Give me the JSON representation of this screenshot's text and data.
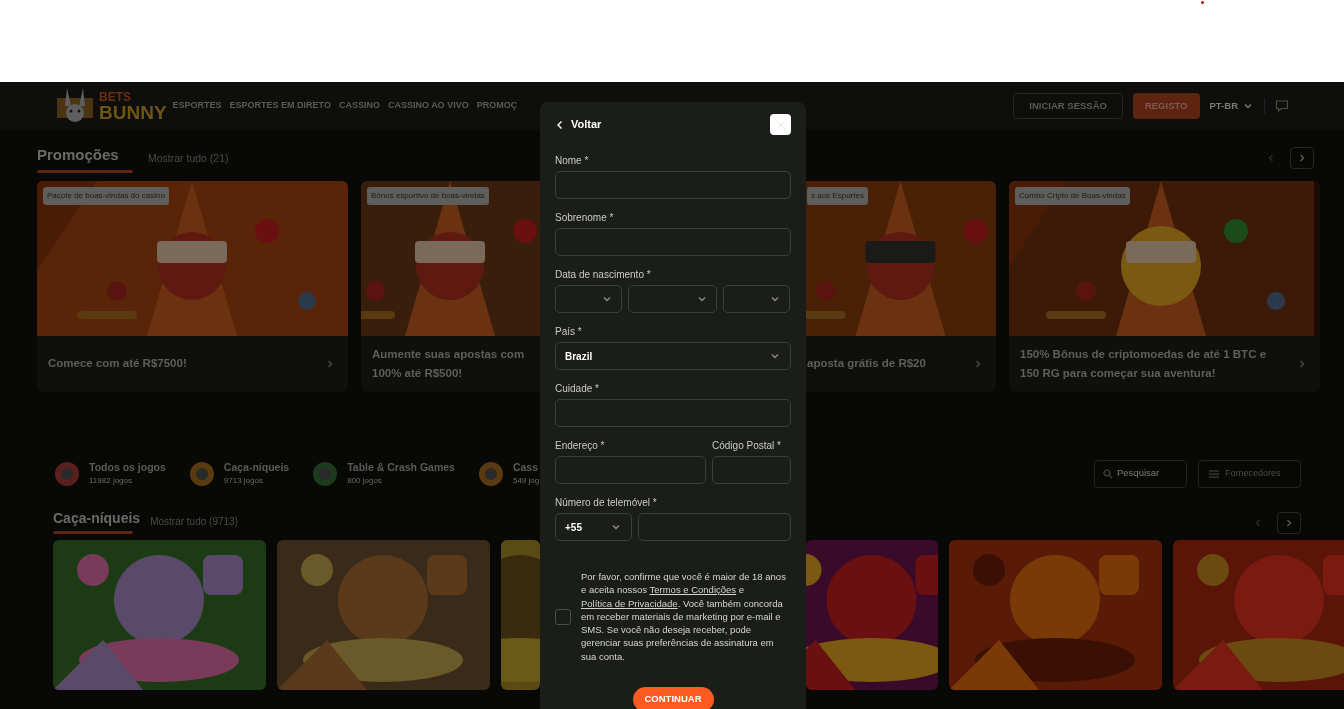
{
  "header": {
    "logo": {
      "line1": "BETS",
      "line2": "BUNNY"
    },
    "nav": [
      "ESPORTES",
      "ESPORTES EM DIRETO",
      "CASSINO",
      "CASSINO AO VIVO",
      "PROMOÇ"
    ],
    "login": "INICIAR SESSÃO",
    "register": "REGISTO",
    "language": "PT-BR"
  },
  "promotions": {
    "title": "Promoções",
    "show_all": "Mostrar tudo (21)",
    "cards": [
      {
        "tag": "Pacote de boas-vindas do casino",
        "text": "Comece com até R$7500!"
      },
      {
        "tag": "Bônus esportivo de boas-vindas",
        "text": "Aumente suas apostas com 100% até R$500!"
      },
      {
        "tag": "s aos Esportes",
        "text": "aposta grátis de R$20"
      },
      {
        "tag": "Combo Cripto de Boas-vindas",
        "text": "150% Bônus de criptomoedas de até 1 BTC e 150 RG para começar sua aventura!"
      }
    ]
  },
  "categories": [
    {
      "name": "Todos os jogos",
      "count": "11982 jogos"
    },
    {
      "name": "Caça-níqueis",
      "count": "9713 jogos"
    },
    {
      "name": "Table & Crash Games",
      "count": "800 jogos"
    },
    {
      "name": "Cass",
      "count": "549 jog"
    }
  ],
  "search": {
    "placeholder": "Pesquisar"
  },
  "providers": "Fornecedores",
  "slots": {
    "title": "Caça-níqueis",
    "show_all": "Mostrar tudo (9713)"
  },
  "registration_modal": {
    "back": "Voltar",
    "name": {
      "label": "Nome *"
    },
    "surname": {
      "label": "Sobrenome *"
    },
    "birth_date": {
      "label": "Data de nascimento *"
    },
    "country": {
      "label": "País *",
      "value": "Brazil"
    },
    "city": {
      "label": "Cuidade *"
    },
    "address": {
      "label": "Endereço *"
    },
    "postal_code": {
      "label": "Código Postal *"
    },
    "phone": {
      "label": "Número de telemóvel *",
      "code": "+55"
    },
    "consent": {
      "checked": false,
      "text_before": "Por favor, confirme que você é maior de 18 anos e aceita nossos ",
      "terms_link": "Termos e Condições",
      "between": " e ",
      "privacy_link": "Política de Privacidade",
      "text_after": ". Você também concorda em receber materiais de marketing por e-mail e SMS. Se você não deseja receber, pode gerenciar suas preferências de assinatura em sua conta."
    },
    "continue": "CONTINUAR"
  }
}
